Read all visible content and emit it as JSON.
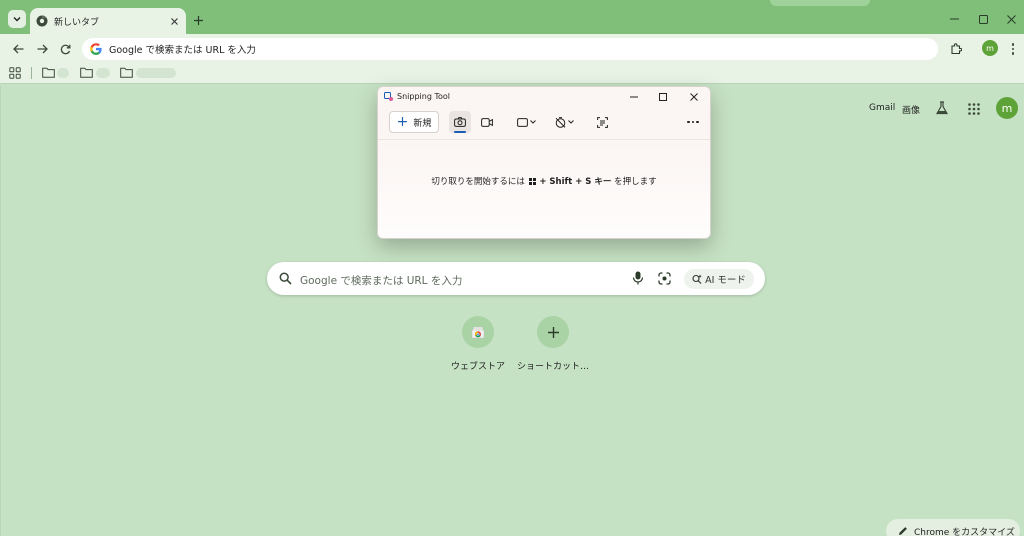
{
  "browser": {
    "tab_title": "新しいタブ",
    "omnibox_text": "Google で検索または URL を入力",
    "profile_initial": "m"
  },
  "ntp": {
    "header": {
      "gmail": "Gmail",
      "images": "画像",
      "avatar_initial": "m"
    },
    "search_placeholder": "Google で検索または URL を入力",
    "ai_mode_label": "AI モード",
    "shortcuts": [
      {
        "label": "ウェブストア",
        "icon": "chrome-webstore-icon"
      },
      {
        "label": "ショートカット…",
        "icon": "plus-icon"
      }
    ],
    "customize_label": "Chrome をカスタマイズ"
  },
  "snipping_tool": {
    "title": "Snipping Tool",
    "new_label": "新規",
    "hint_prefix": "切り取りを開始するには",
    "hint_shortcut": "+ Shift + S キー",
    "hint_suffix": "を押します"
  },
  "colors": {
    "page_bg": "#c6e2c4",
    "tabstrip": "#7fbf7a",
    "toolbar": "#e8f3e6",
    "accent": "#5ea338",
    "snip_accent": "#1a5fb4"
  }
}
